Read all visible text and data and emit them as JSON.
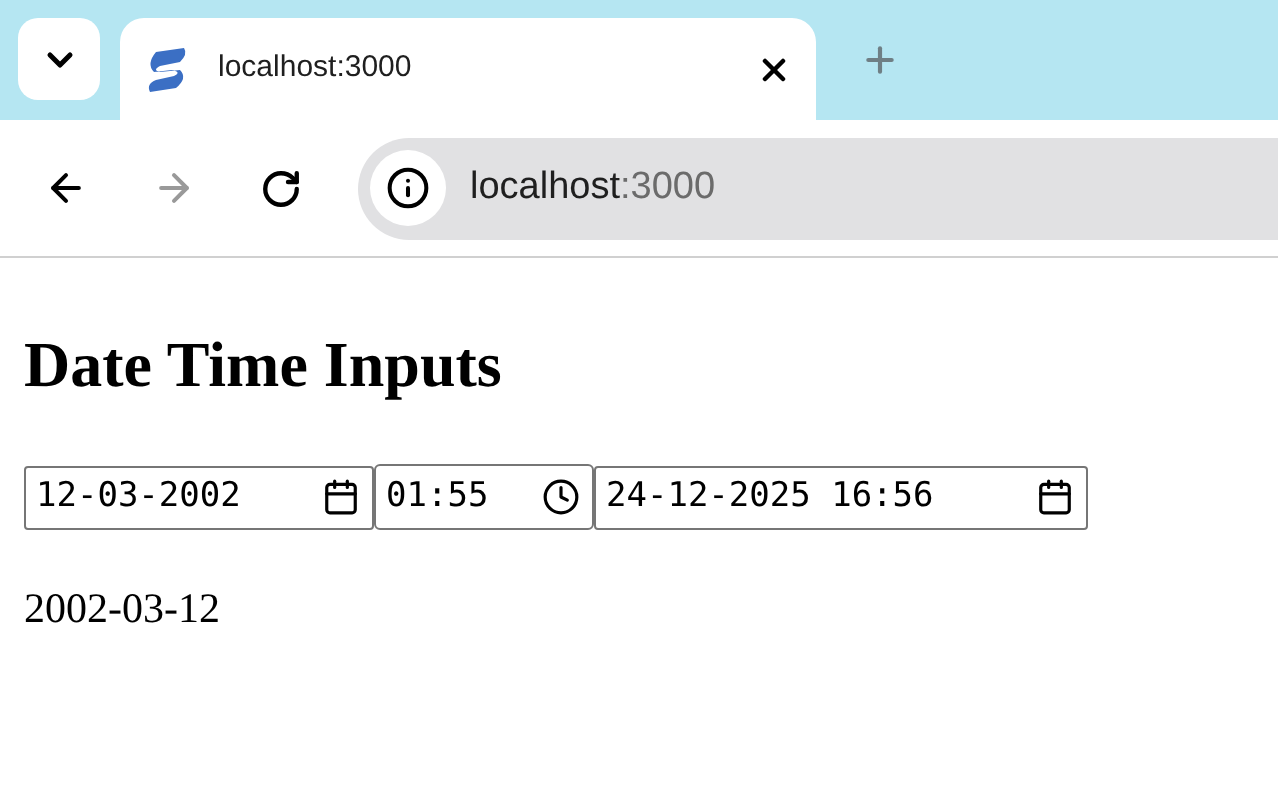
{
  "browser": {
    "tab": {
      "title": "localhost:3000"
    },
    "address": {
      "host": "localhost",
      "port": ":3000"
    }
  },
  "page": {
    "heading": "Date Time Inputs",
    "inputs": [
      {
        "kind": "date",
        "value": "12-03-2002"
      },
      {
        "kind": "time",
        "value": "01:55"
      },
      {
        "kind": "datetime",
        "value": "24-12-2025 16:56"
      }
    ],
    "output": "2002-03-12"
  }
}
